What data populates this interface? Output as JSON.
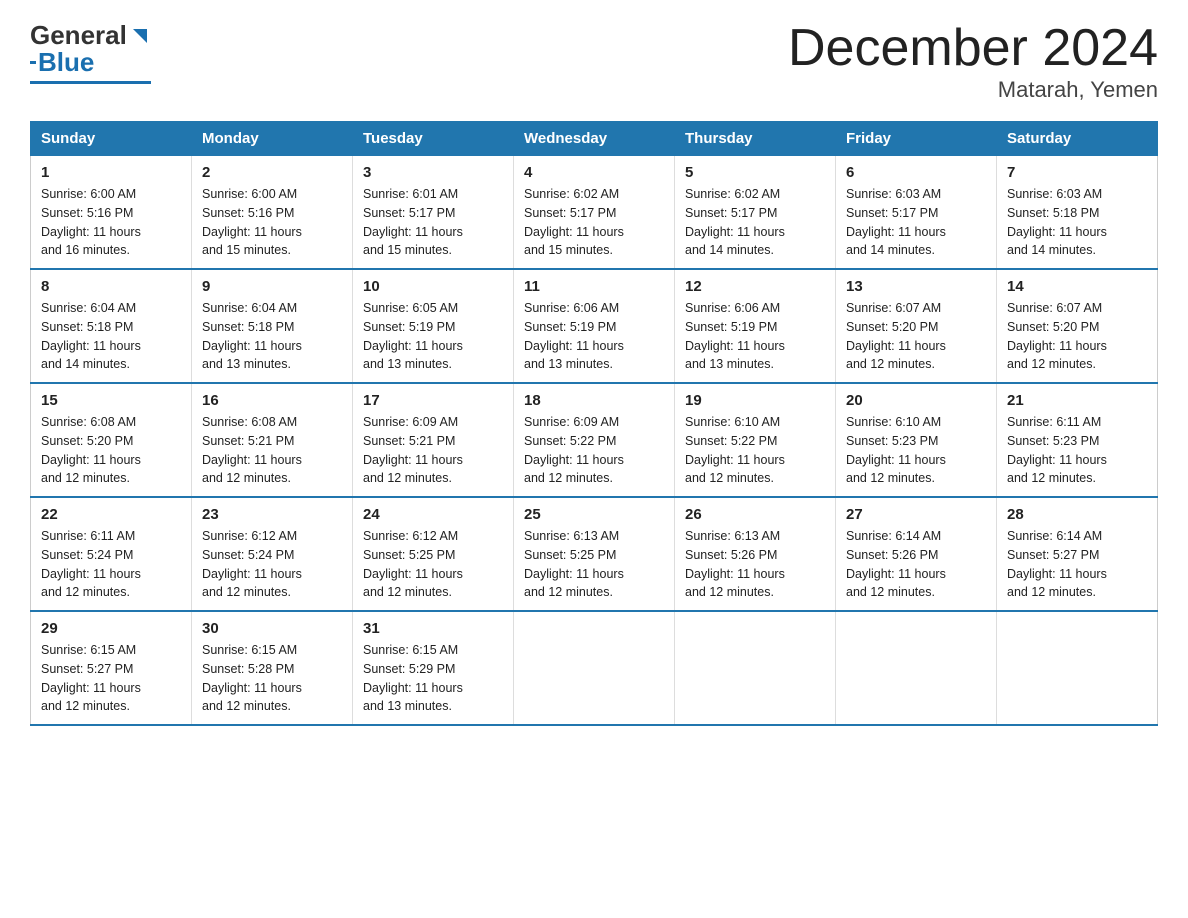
{
  "header": {
    "logo_general": "General",
    "logo_blue": "Blue",
    "month_title": "December 2024",
    "location": "Matarah, Yemen"
  },
  "days_of_week": [
    "Sunday",
    "Monday",
    "Tuesday",
    "Wednesday",
    "Thursday",
    "Friday",
    "Saturday"
  ],
  "weeks": [
    [
      {
        "num": "1",
        "sunrise": "6:00 AM",
        "sunset": "5:16 PM",
        "daylight": "11 hours and 16 minutes."
      },
      {
        "num": "2",
        "sunrise": "6:00 AM",
        "sunset": "5:16 PM",
        "daylight": "11 hours and 15 minutes."
      },
      {
        "num": "3",
        "sunrise": "6:01 AM",
        "sunset": "5:17 PM",
        "daylight": "11 hours and 15 minutes."
      },
      {
        "num": "4",
        "sunrise": "6:02 AM",
        "sunset": "5:17 PM",
        "daylight": "11 hours and 15 minutes."
      },
      {
        "num": "5",
        "sunrise": "6:02 AM",
        "sunset": "5:17 PM",
        "daylight": "11 hours and 14 minutes."
      },
      {
        "num": "6",
        "sunrise": "6:03 AM",
        "sunset": "5:17 PM",
        "daylight": "11 hours and 14 minutes."
      },
      {
        "num": "7",
        "sunrise": "6:03 AM",
        "sunset": "5:18 PM",
        "daylight": "11 hours and 14 minutes."
      }
    ],
    [
      {
        "num": "8",
        "sunrise": "6:04 AM",
        "sunset": "5:18 PM",
        "daylight": "11 hours and 14 minutes."
      },
      {
        "num": "9",
        "sunrise": "6:04 AM",
        "sunset": "5:18 PM",
        "daylight": "11 hours and 13 minutes."
      },
      {
        "num": "10",
        "sunrise": "6:05 AM",
        "sunset": "5:19 PM",
        "daylight": "11 hours and 13 minutes."
      },
      {
        "num": "11",
        "sunrise": "6:06 AM",
        "sunset": "5:19 PM",
        "daylight": "11 hours and 13 minutes."
      },
      {
        "num": "12",
        "sunrise": "6:06 AM",
        "sunset": "5:19 PM",
        "daylight": "11 hours and 13 minutes."
      },
      {
        "num": "13",
        "sunrise": "6:07 AM",
        "sunset": "5:20 PM",
        "daylight": "11 hours and 12 minutes."
      },
      {
        "num": "14",
        "sunrise": "6:07 AM",
        "sunset": "5:20 PM",
        "daylight": "11 hours and 12 minutes."
      }
    ],
    [
      {
        "num": "15",
        "sunrise": "6:08 AM",
        "sunset": "5:20 PM",
        "daylight": "11 hours and 12 minutes."
      },
      {
        "num": "16",
        "sunrise": "6:08 AM",
        "sunset": "5:21 PM",
        "daylight": "11 hours and 12 minutes."
      },
      {
        "num": "17",
        "sunrise": "6:09 AM",
        "sunset": "5:21 PM",
        "daylight": "11 hours and 12 minutes."
      },
      {
        "num": "18",
        "sunrise": "6:09 AM",
        "sunset": "5:22 PM",
        "daylight": "11 hours and 12 minutes."
      },
      {
        "num": "19",
        "sunrise": "6:10 AM",
        "sunset": "5:22 PM",
        "daylight": "11 hours and 12 minutes."
      },
      {
        "num": "20",
        "sunrise": "6:10 AM",
        "sunset": "5:23 PM",
        "daylight": "11 hours and 12 minutes."
      },
      {
        "num": "21",
        "sunrise": "6:11 AM",
        "sunset": "5:23 PM",
        "daylight": "11 hours and 12 minutes."
      }
    ],
    [
      {
        "num": "22",
        "sunrise": "6:11 AM",
        "sunset": "5:24 PM",
        "daylight": "11 hours and 12 minutes."
      },
      {
        "num": "23",
        "sunrise": "6:12 AM",
        "sunset": "5:24 PM",
        "daylight": "11 hours and 12 minutes."
      },
      {
        "num": "24",
        "sunrise": "6:12 AM",
        "sunset": "5:25 PM",
        "daylight": "11 hours and 12 minutes."
      },
      {
        "num": "25",
        "sunrise": "6:13 AM",
        "sunset": "5:25 PM",
        "daylight": "11 hours and 12 minutes."
      },
      {
        "num": "26",
        "sunrise": "6:13 AM",
        "sunset": "5:26 PM",
        "daylight": "11 hours and 12 minutes."
      },
      {
        "num": "27",
        "sunrise": "6:14 AM",
        "sunset": "5:26 PM",
        "daylight": "11 hours and 12 minutes."
      },
      {
        "num": "28",
        "sunrise": "6:14 AM",
        "sunset": "5:27 PM",
        "daylight": "11 hours and 12 minutes."
      }
    ],
    [
      {
        "num": "29",
        "sunrise": "6:15 AM",
        "sunset": "5:27 PM",
        "daylight": "11 hours and 12 minutes."
      },
      {
        "num": "30",
        "sunrise": "6:15 AM",
        "sunset": "5:28 PM",
        "daylight": "11 hours and 12 minutes."
      },
      {
        "num": "31",
        "sunrise": "6:15 AM",
        "sunset": "5:29 PM",
        "daylight": "11 hours and 13 minutes."
      },
      null,
      null,
      null,
      null
    ]
  ],
  "labels": {
    "sunrise": "Sunrise:",
    "sunset": "Sunset:",
    "daylight": "Daylight:"
  }
}
